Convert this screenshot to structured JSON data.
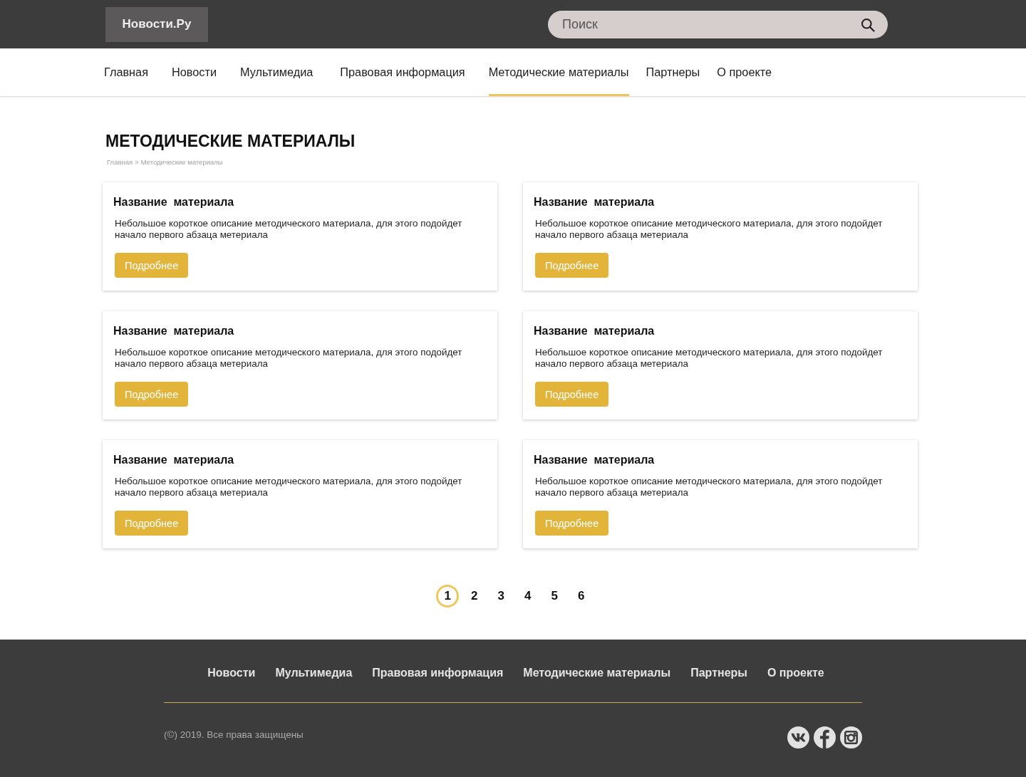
{
  "header": {
    "logo": "Новости.Ру",
    "search": {
      "placeholder": "Поиск"
    }
  },
  "nav": [
    {
      "label": "Главная",
      "selected": false
    },
    {
      "label": "Новости",
      "selected": false
    },
    {
      "label": "Мультимедиа",
      "selected": false
    },
    {
      "label": "Правовая информация",
      "selected": false
    },
    {
      "label": "Методические материалы",
      "selected": true
    },
    {
      "label": "Партнеры",
      "selected": false
    },
    {
      "label": "О проекте",
      "selected": false
    }
  ],
  "page": {
    "title": "МЕТОДИЧЕСКИЕ МАТЕРИАЛЫ",
    "breadcrumb": {
      "items": [
        "Главная",
        "Методические материалы"
      ],
      "separator": ">"
    }
  },
  "cards": [
    {
      "title": "Название  материала",
      "description": "Небольшое короткое описание методического материала, для этого подойдет начало первого абзаца метериала",
      "button": "Подробнее"
    },
    {
      "title": "Название  материала",
      "description": "Небольшое короткое описание методического материала, для этого подойдет начало первого абзаца метериала",
      "button": "Подробнее"
    },
    {
      "title": "Название  материала",
      "description": "Небольшое короткое описание методического материала, для этого подойдет начало первого абзаца метериала",
      "button": "Подробнее"
    },
    {
      "title": "Название  материала",
      "description": "Небольшое короткое описание методического материала, для этого подойдет начало первого абзаца метериала",
      "button": "Подробнее"
    },
    {
      "title": "Название  материала",
      "description": "Небольшое короткое описание методического материала, для этого подойдет начало первого абзаца метериала",
      "button": "Подробнее"
    },
    {
      "title": "Название  материала",
      "description": "Небольшое короткое описание методического материала, для этого подойдет начало первого абзаца метериала",
      "button": "Подробнее"
    }
  ],
  "pagination": [
    {
      "label": "1",
      "selected": true
    },
    {
      "label": "2",
      "selected": false
    },
    {
      "label": "3",
      "selected": false
    },
    {
      "label": "4",
      "selected": false
    },
    {
      "label": "5",
      "selected": false
    },
    {
      "label": "6",
      "selected": false
    }
  ],
  "footer": {
    "links": [
      "Новости",
      "Мультимедиа",
      "Правовая информация",
      "Методические материалы",
      "Партнеры",
      "О проекте"
    ],
    "copyright": "(©) 2019. Все права защищены",
    "social": [
      {
        "kind": "vk"
      },
      {
        "kind": "facebook"
      },
      {
        "kind": "instagram"
      }
    ]
  }
}
